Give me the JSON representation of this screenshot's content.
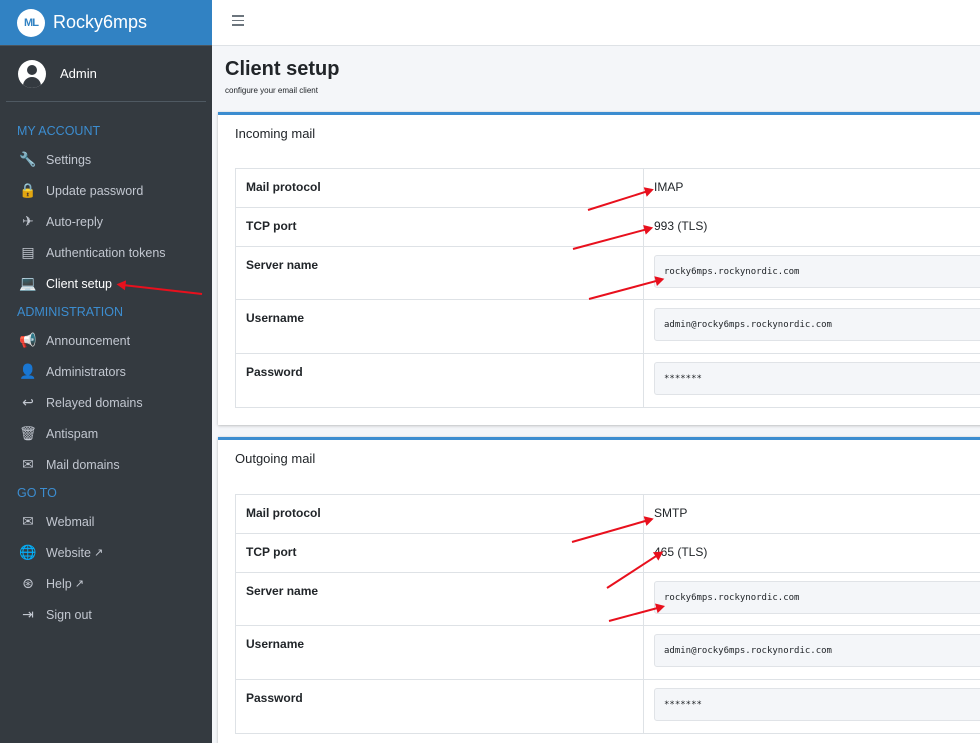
{
  "brand": {
    "name": "Rocky6mps",
    "logo_text": "ML"
  },
  "user": {
    "name": "Admin"
  },
  "sidebar": {
    "sections": [
      {
        "header": "MY ACCOUNT",
        "items": [
          {
            "label": "Settings",
            "icon": "wrench-icon",
            "glyph": "🔧"
          },
          {
            "label": "Update password",
            "icon": "lock-icon",
            "glyph": "🔒"
          },
          {
            "label": "Auto-reply",
            "icon": "plane-icon",
            "glyph": "✈"
          },
          {
            "label": "Authentication tokens",
            "icon": "keyboard-icon",
            "glyph": "▤"
          },
          {
            "label": "Client setup",
            "icon": "laptop-icon",
            "glyph": "💻",
            "active": true
          }
        ]
      },
      {
        "header": "ADMINISTRATION",
        "items": [
          {
            "label": "Announcement",
            "icon": "bullhorn-icon",
            "glyph": "📢"
          },
          {
            "label": "Administrators",
            "icon": "user-icon",
            "glyph": "👤"
          },
          {
            "label": "Relayed domains",
            "icon": "reply-all-icon",
            "glyph": "↩"
          },
          {
            "label": "Antispam",
            "icon": "trash-icon",
            "glyph": "🗑"
          },
          {
            "label": "Mail domains",
            "icon": "envelope-icon",
            "glyph": "✉"
          }
        ]
      },
      {
        "header": "GO TO",
        "items": [
          {
            "label": "Webmail",
            "icon": "envelope-outline-icon",
            "glyph": "✉"
          },
          {
            "label": "Website",
            "icon": "globe-icon",
            "glyph": "🌐",
            "external": true
          },
          {
            "label": "Help",
            "icon": "life-ring-icon",
            "glyph": "⊛",
            "external": true
          },
          {
            "label": "Sign out",
            "icon": "sign-out-icon",
            "glyph": "⇥"
          }
        ]
      }
    ]
  },
  "page": {
    "title": "Client setup",
    "subtitle": "configure your email client"
  },
  "incoming": {
    "title": "Incoming mail",
    "rows": [
      {
        "label": "Mail protocol",
        "value": "IMAP"
      },
      {
        "label": "TCP port",
        "value": "993 (TLS)"
      },
      {
        "label": "Server name",
        "value": "rocky6mps.rockynordic.com"
      },
      {
        "label": "Username",
        "value": "admin@rocky6mps.rockynordic.com"
      },
      {
        "label": "Password",
        "value": "*******"
      }
    ]
  },
  "outgoing": {
    "title": "Outgoing mail",
    "rows": [
      {
        "label": "Mail protocol",
        "value": "SMTP"
      },
      {
        "label": "TCP port",
        "value": "465 (TLS)"
      },
      {
        "label": "Server name",
        "value": "rocky6mps.rockynordic.com"
      },
      {
        "label": "Username",
        "value": "admin@rocky6mps.rockynordic.com"
      },
      {
        "label": "Password",
        "value": "*******"
      }
    ]
  },
  "colors": {
    "accent": "#3c8dd0",
    "sidebar": "#343a40",
    "brand_bg": "#3182c3",
    "annotation": "#e8101d"
  }
}
